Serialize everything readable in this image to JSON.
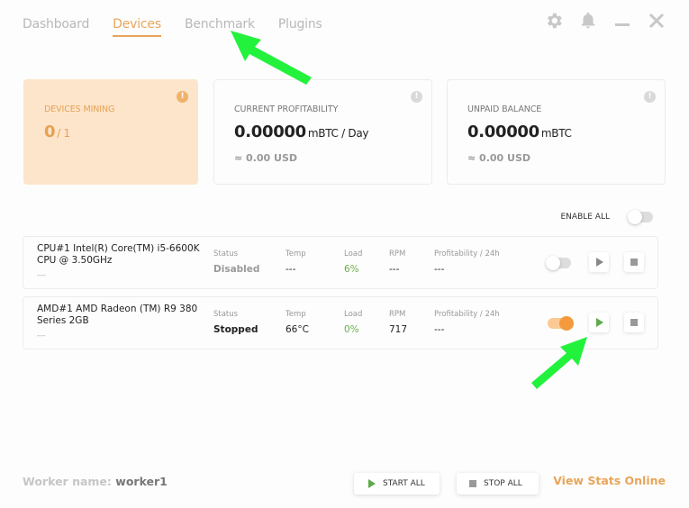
{
  "nav": {
    "tabs": [
      {
        "label": "Dashboard",
        "active": false
      },
      {
        "label": "Devices",
        "active": true
      },
      {
        "label": "Benchmark",
        "active": false
      },
      {
        "label": "Plugins",
        "active": false
      }
    ]
  },
  "window_icons": [
    "gear-icon",
    "bell-icon",
    "minimize-icon",
    "close-icon"
  ],
  "cards": {
    "devices_mining": {
      "title": "DEVICES MINING",
      "value": "0",
      "total": "/ 1",
      "info": "!"
    },
    "profitability": {
      "title": "CURRENT PROFITABILITY",
      "value": "0.00000",
      "unit": "mBTC / Day",
      "sub": "≈ 0.00 USD",
      "info": "!"
    },
    "unpaid": {
      "title": "UNPAID BALANCE",
      "value": "0.00000",
      "unit": "mBTC",
      "sub": "≈ 0.00 USD",
      "info": "!"
    }
  },
  "enable_all": {
    "label": "ENABLE ALL",
    "on": false
  },
  "columns": {
    "status": "Status",
    "temp": "Temp",
    "load": "Load",
    "rpm": "RPM",
    "profit": "Profitability / 24h"
  },
  "devices": [
    {
      "name": "CPU#1 Intel(R) Core(TM) i5-6600K CPU @ 3.50GHz",
      "sub": "---",
      "status": "Disabled",
      "temp": "---",
      "load": "6%",
      "rpm": "---",
      "profit": "---",
      "enabled": false
    },
    {
      "name": "AMD#1 AMD Radeon (TM) R9 380 Series 2GB",
      "sub": "---",
      "status": "Stopped",
      "temp": "66°C",
      "load": "0%",
      "rpm": "717",
      "profit": "---",
      "enabled": true
    }
  ],
  "footer": {
    "worker_label": "Worker name:",
    "worker_value": "worker1",
    "start_all": "START ALL",
    "stop_all": "STOP ALL",
    "view_stats": "View Stats Online"
  },
  "colors": {
    "accent": "#e8a55a",
    "card_orange_bg": "#fde5cb",
    "load_green": "#6ab04c",
    "annotation_green": "#22f23c"
  }
}
